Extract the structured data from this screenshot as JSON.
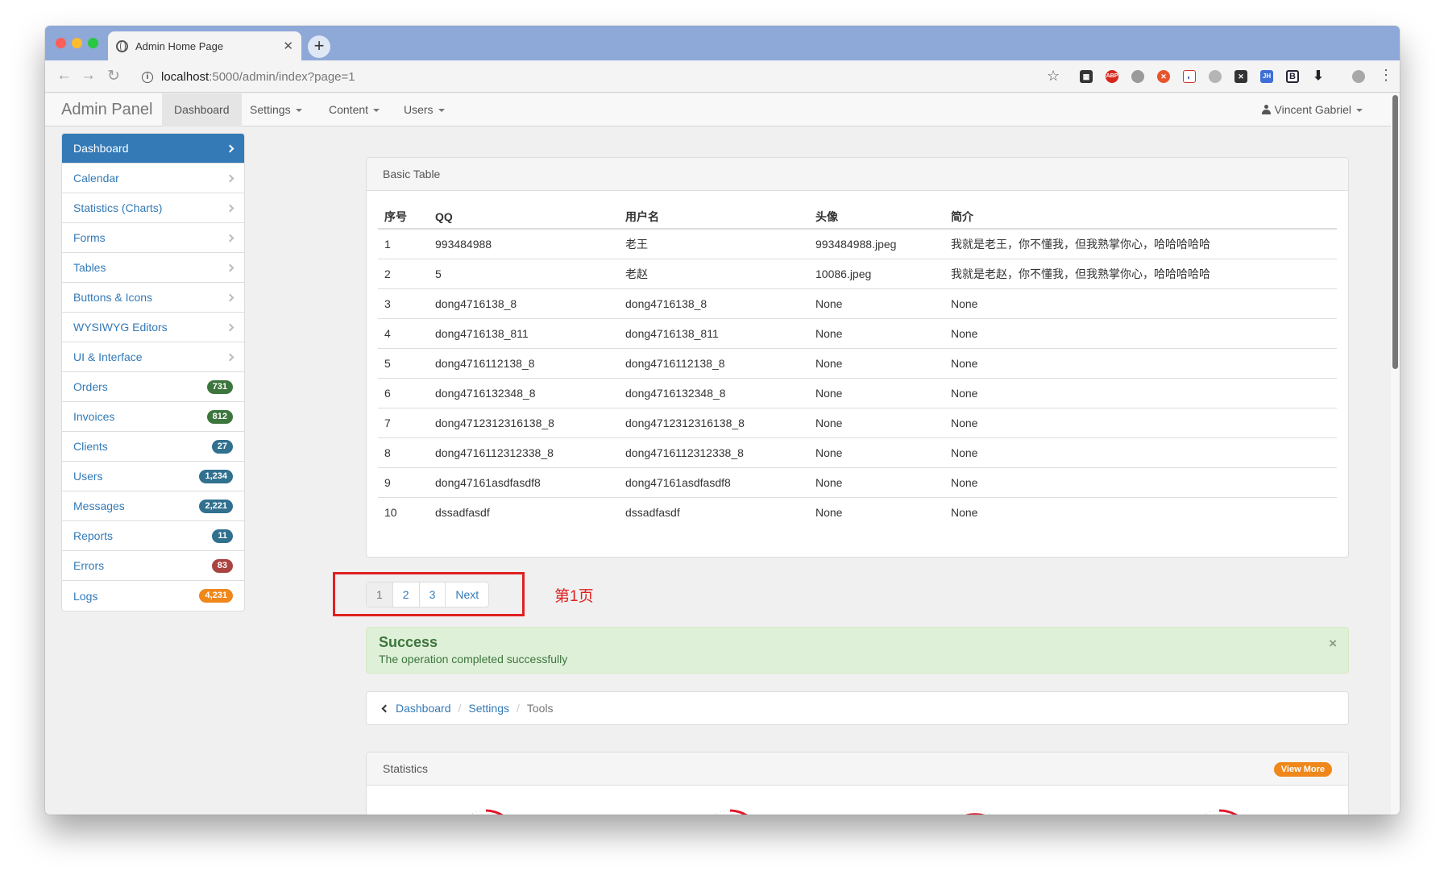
{
  "browser": {
    "tab_title": "Admin Home Page",
    "url_host": "localhost",
    "url_rest": ":5000/admin/index?page=1"
  },
  "navbar": {
    "brand": "Admin Panel",
    "items": [
      {
        "label": "Dashboard",
        "active": true,
        "dropdown": false
      },
      {
        "label": "Settings",
        "dropdown": true
      },
      {
        "label": "Content",
        "dropdown": true
      },
      {
        "label": "Users",
        "dropdown": true
      }
    ],
    "user": "Vincent Gabriel"
  },
  "sidebar": {
    "items": [
      {
        "label": "Dashboard",
        "active": true
      },
      {
        "label": "Calendar"
      },
      {
        "label": "Statistics (Charts)"
      },
      {
        "label": "Forms"
      },
      {
        "label": "Tables"
      },
      {
        "label": "Buttons & Icons"
      },
      {
        "label": "WYSIWYG Editors"
      },
      {
        "label": "UI & Interface"
      },
      {
        "label": "Orders",
        "badge": "731",
        "badge_color": "#3c763d"
      },
      {
        "label": "Invoices",
        "badge": "812",
        "badge_color": "#3c763d"
      },
      {
        "label": "Clients",
        "badge": "27",
        "badge_color": "#31708f"
      },
      {
        "label": "Users",
        "badge": "1,234",
        "badge_color": "#31708f"
      },
      {
        "label": "Messages",
        "badge": "2,221",
        "badge_color": "#31708f"
      },
      {
        "label": "Reports",
        "badge": "11",
        "badge_color": "#31708f"
      },
      {
        "label": "Errors",
        "badge": "83",
        "badge_color": "#a94442"
      },
      {
        "label": "Logs",
        "badge": "4,231",
        "badge_color": "#f0871b"
      }
    ]
  },
  "table_panel": {
    "title": "Basic Table",
    "headers": [
      "序号",
      "QQ",
      "用户名",
      "头像",
      "简介"
    ],
    "rows": [
      [
        "1",
        "993484988",
        "老王",
        "993484988.jpeg",
        "我就是老王，你不懂我，但我熟掌你心，哈哈哈哈哈"
      ],
      [
        "2",
        "5",
        "老赵",
        "10086.jpeg",
        "我就是老赵，你不懂我，但我熟掌你心，哈哈哈哈哈"
      ],
      [
        "3",
        "dong4716138_8",
        "dong4716138_8",
        "None",
        "None"
      ],
      [
        "4",
        "dong4716138_811",
        "dong4716138_811",
        "None",
        "None"
      ],
      [
        "5",
        "dong4716112138_8",
        "dong4716112138_8",
        "None",
        "None"
      ],
      [
        "6",
        "dong4716132348_8",
        "dong4716132348_8",
        "None",
        "None"
      ],
      [
        "7",
        "dong4712312316138_8",
        "dong4712312316138_8",
        "None",
        "None"
      ],
      [
        "8",
        "dong4716112312338_8",
        "dong4716112312338_8",
        "None",
        "None"
      ],
      [
        "9",
        "dong47161asdfasdf8",
        "dong47161asdfasdf8",
        "None",
        "None"
      ],
      [
        "10",
        "dssadfasdf",
        "dssadfasdf",
        "None",
        "None"
      ]
    ]
  },
  "pagination": {
    "pages": [
      "1",
      "2",
      "3"
    ],
    "current": "1",
    "next": "Next",
    "annotation": "第1页"
  },
  "alert": {
    "title": "Success",
    "message": "The operation completed successfully",
    "close": "×"
  },
  "breadcrumb": {
    "items": [
      "Dashboard",
      "Settings"
    ],
    "current": "Tools"
  },
  "stats_panel": {
    "title": "Statistics",
    "view_more": "View More"
  },
  "colors": {
    "primary": "#337ab7",
    "annotation_red": "#e02020",
    "success_bg": "#dff0d8",
    "gauge_red": "#e0182d"
  }
}
